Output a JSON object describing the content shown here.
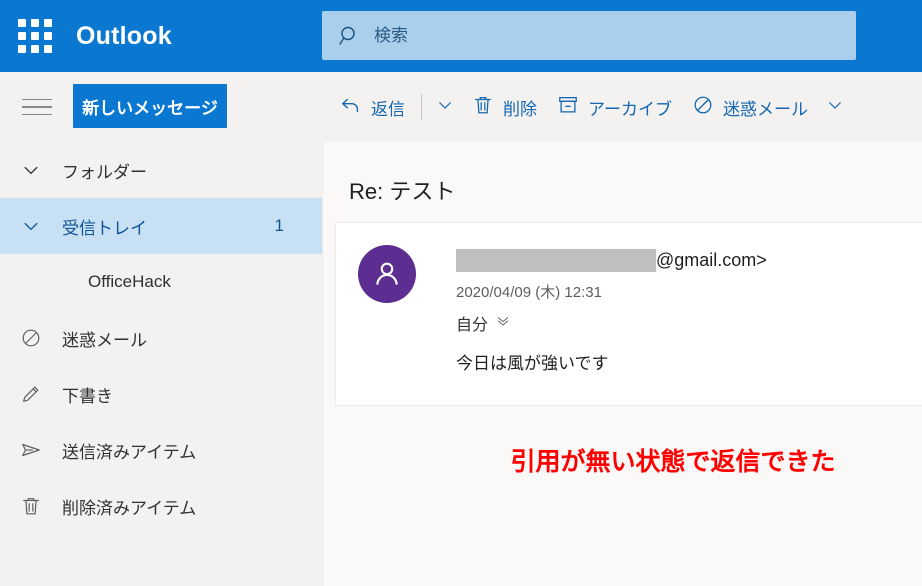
{
  "app": {
    "brand": "Outlook",
    "waffle_icon": "app-grid-icon",
    "hamburger_icon": "hamburger-menu-icon"
  },
  "search": {
    "placeholder": "検索",
    "value": "",
    "icon": "search-icon"
  },
  "compose": {
    "new_message_label": "新しいメッセージ"
  },
  "toolbar": {
    "items": [
      {
        "label": "返信",
        "icon": "reply-arrow-icon"
      },
      {
        "label": "",
        "icon": "chevron-down-icon"
      },
      {
        "label": "削除",
        "icon": "trash-icon"
      },
      {
        "label": "アーカイブ",
        "icon": "archive-box-icon"
      },
      {
        "label": "迷惑メール",
        "icon": "block-circle-slash-icon"
      },
      {
        "label": "",
        "icon": "chevron-down-icon"
      }
    ]
  },
  "sidebar": {
    "items": [
      {
        "label": "フォルダー",
        "icon": "chevron-down-icon",
        "badge": "",
        "selected": false,
        "child": false
      },
      {
        "label": "受信トレイ",
        "icon": "chevron-down-icon",
        "badge": "1",
        "selected": true,
        "child": false
      },
      {
        "label": "OfficeHack",
        "icon": "",
        "badge": "",
        "selected": false,
        "child": true
      },
      {
        "label": "迷惑メール",
        "icon": "block-circle-slash-icon",
        "badge": "",
        "selected": false,
        "child": false
      },
      {
        "label": "下書き",
        "icon": "pencil-icon",
        "badge": "",
        "selected": false,
        "child": false
      },
      {
        "label": "送信済みアイテム",
        "icon": "paper-plane-icon",
        "badge": "",
        "selected": false,
        "child": false
      },
      {
        "label": "削除済みアイテム",
        "icon": "trash-icon",
        "badge": "",
        "selected": false,
        "child": false
      }
    ]
  },
  "message": {
    "subject": "Re: テスト",
    "avatar_icon": "person-avatar-icon",
    "sender_redacted": true,
    "sender_domain": "@gmail.com>",
    "date": "2020/04/09 (木) 12:31",
    "recipient": "自分",
    "expand_icon": "double-chevron-down-icon",
    "body": "今日は風が強いです"
  },
  "annotation": {
    "text": "引用が無い状態で返信できた",
    "color": "#ff0000"
  },
  "colors": {
    "brand_blue": "#0a78d1",
    "search_field": "#a9cfec",
    "sidebar_bg": "#f3f2f1",
    "selected_row": "#c7e0f4",
    "selected_text": "#0f5397",
    "avatar_purple": "#5c2e91",
    "pane_bg": "#faf9f8",
    "annotation_red": "#ff0000"
  }
}
